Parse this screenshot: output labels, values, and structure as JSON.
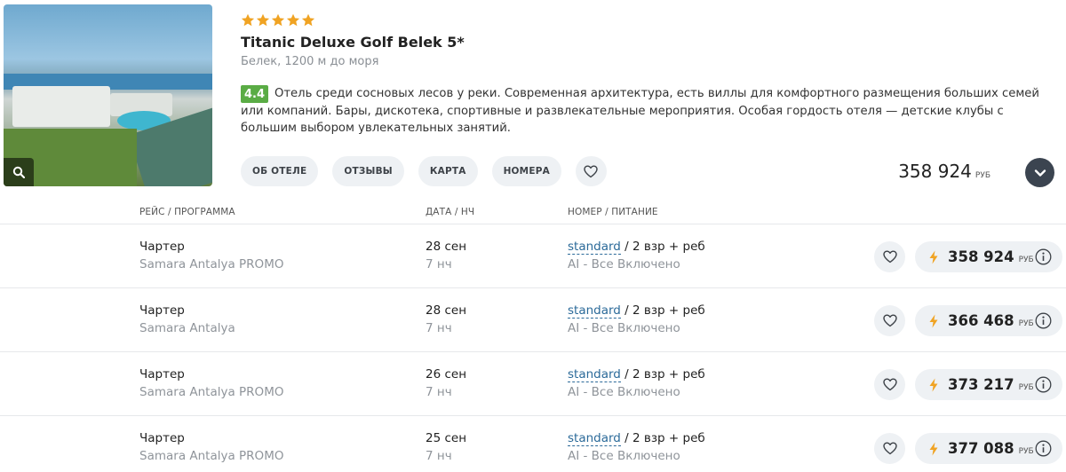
{
  "hotel": {
    "stars": 5,
    "star_color": "#f0a323",
    "title": "Titanic Deluxe Golf Belek 5*",
    "location": "Белек, 1200 м до моря",
    "rating": "4.4",
    "rating_color": "#5aac45",
    "description": "Отель среди сосновых лесов у реки. Современная архитектура, есть виллы для комфортного размещения больших семей или компаний. Бары, дискотека, спортивные и развлекательные мероприятия. Особая гордость отеля — детские клубы с большим выбором увлекательных занятий.",
    "photo_icon": "search-icon",
    "tabs": [
      {
        "label": "ОБ ОТЕЛЕ"
      },
      {
        "label": "ОТЗЫВЫ"
      },
      {
        "label": "КАРТА"
      },
      {
        "label": "НОМЕРА"
      }
    ],
    "favorite_icon": "heart-icon",
    "price": "358 924",
    "currency": "РУБ",
    "expand_icon": "chevron-down-icon"
  },
  "tour_table": {
    "headers": {
      "flight": "РЕЙС / ПРОГРАММА",
      "date": "ДАТА / НЧ",
      "room": "НОМЕР / ПИТАНИЕ"
    },
    "rows": [
      {
        "flight_type": "Чартер",
        "program": "Samara Antalya PROMO",
        "date": "28 сен",
        "nights": "7 нч",
        "room": "standard",
        "guests": " / 2 взр + реб",
        "meal": "AI - Все Включено",
        "price": "358 924",
        "currency": "РУБ"
      },
      {
        "flight_type": "Чартер",
        "program": "Samara Antalya",
        "date": "28 сен",
        "nights": "7 нч",
        "room": "standard",
        "guests": " / 2 взр + реб",
        "meal": "AI - Все Включено",
        "price": "366 468",
        "currency": "РУБ"
      },
      {
        "flight_type": "Чартер",
        "program": "Samara Antalya PROMO",
        "date": "26 сен",
        "nights": "7 нч",
        "room": "standard",
        "guests": " / 2 взр + реб",
        "meal": "AI - Все Включено",
        "price": "373 217",
        "currency": "РУБ"
      },
      {
        "flight_type": "Чартер",
        "program": "Samara Antalya PROMO",
        "date": "25 сен",
        "nights": "7 нч",
        "room": "standard",
        "guests": " / 2 взр + реб",
        "meal": "AI - Все Включено",
        "price": "377 088",
        "currency": "РУБ"
      }
    ],
    "bolt_color": "#f0a323",
    "row_icons": [
      "heart-icon",
      "lightning-icon",
      "info-icon"
    ]
  }
}
